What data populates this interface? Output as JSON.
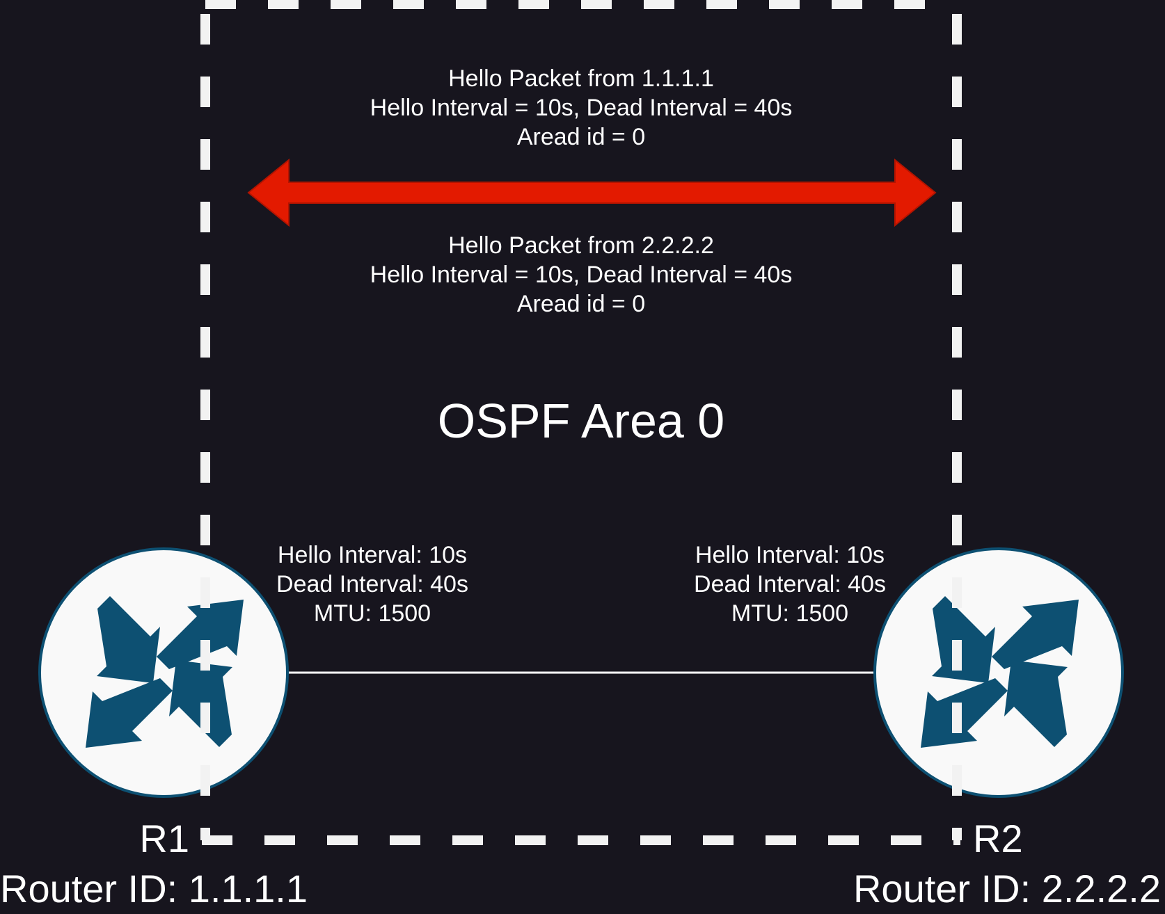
{
  "area": {
    "label": "OSPF Area 0"
  },
  "hello_from_r1": {
    "lines": [
      "Hello Packet from 1.1.1.1",
      "Hello Interval = 10s, Dead Interval = 40s",
      "Aread id = 0"
    ]
  },
  "hello_from_r2": {
    "lines": [
      "Hello Packet from 2.2.2.2",
      "Hello Interval = 10s, Dead Interval = 40s",
      "Aread id = 0"
    ]
  },
  "routers": [
    {
      "name": "R1",
      "router_id": "Router ID: 1.1.1.1",
      "config": [
        "Hello Interval: 10s",
        "Dead Interval: 40s",
        "MTU: 1500"
      ],
      "icon": "router-icon"
    },
    {
      "name": "R2",
      "router_id": "Router ID: 2.2.2.2",
      "config": [
        "Hello Interval: 10s",
        "Dead Interval: 40s",
        "MTU: 1500"
      ],
      "icon": "router-icon"
    }
  ],
  "colors": {
    "background": "#17151e",
    "router_fill": "#f9f9f9",
    "router_stroke": "#0d5072",
    "router_arrows": "#0d5072",
    "hello_arrow": "#e31a00",
    "area_border": "#f2f2f2",
    "link": "#ffffff"
  }
}
